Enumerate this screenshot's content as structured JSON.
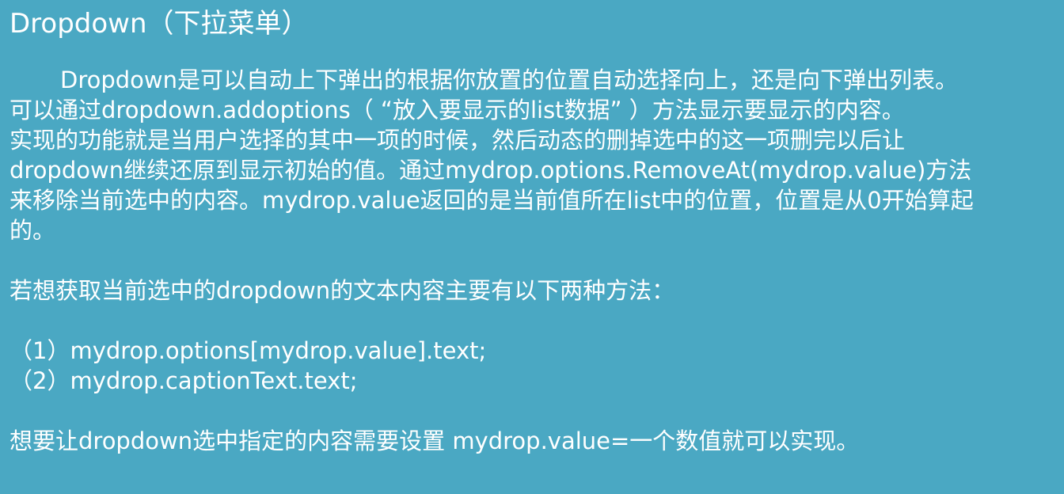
{
  "title": "Dropdown（下拉菜单）",
  "paragraph1": [
    "Dropdown是可以自动上下弹出的根据你放置的位置自动选择向上，还是向下弹出列表。",
    "可以通过dropdown.addoptions（ “放入要显示的list数据” ）方法显示要显示的内容。",
    "实现的功能就是当用户选择的其中一项的时候，然后动态的删掉选中的这一项删完以后让",
    "dropdown继续还原到显示初始的值。通过mydrop.options.RemoveAt(mydrop.value)方法",
    "来移除当前选中的内容。mydrop.value返回的是当前值所在list中的位置，位置是从0开始算起",
    "的。"
  ],
  "paragraph2": "若想获取当前选中的dropdown的文本内容主要有以下两种方法：",
  "methods": [
    "（1）mydrop.options[mydrop.value].text;",
    "（2）mydrop.captionText.text;"
  ],
  "paragraph3": "想要让dropdown选中指定的内容需要设置  mydrop.value=一个数值就可以实现。"
}
